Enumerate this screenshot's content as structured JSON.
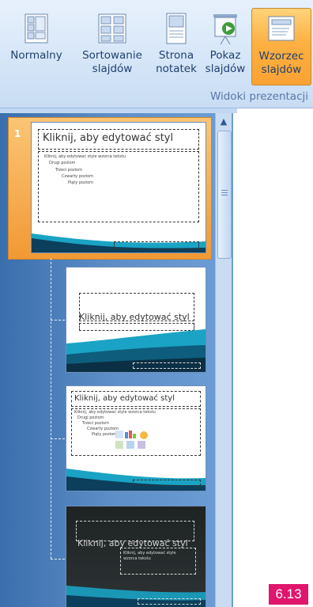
{
  "ribbon": {
    "buttons": [
      {
        "line1": "Normalny",
        "line2": "",
        "icon": "normal-view-icon"
      },
      {
        "line1": "Sortowanie",
        "line2": "slajdów",
        "icon": "slide-sorter-icon"
      },
      {
        "line1": "Strona",
        "line2": "notatek",
        "icon": "notes-page-icon"
      },
      {
        "line1": "Pokaz",
        "line2": "slajdów",
        "icon": "slide-show-icon"
      },
      {
        "line1": "Wzorzec",
        "line2": "slajdów",
        "icon": "slide-master-icon"
      }
    ],
    "group_label": "Widoki prezentacji"
  },
  "slides_panel": {
    "selected_number": "1",
    "master": {
      "title": "Kliknij, aby edytować styl",
      "body": [
        "Kliknij, aby edytować style wzorca tekstu",
        "Drugi poziom",
        "Trzeci poziom",
        "Czwarty poziom",
        "Piąty poziom"
      ]
    },
    "layout2": {
      "title": "Kliknij, aby edytować styl"
    },
    "layout3": {
      "title": "Kliknij, aby edytować styl",
      "body": [
        "Kliknij, aby edytować style wzorca tekstu",
        "Drugi poziom",
        "Trzeci poziom",
        "Czwarty poziom",
        "Piąty poziom"
      ]
    },
    "layout4": {
      "title": "Kliknij, aby edytować styl",
      "body": [
        "Kliknij, aby edytować style",
        "wzorca tekstu"
      ]
    }
  },
  "figure_label": "6.13",
  "colors": {
    "accent_active": "#f9a233",
    "panel_blue": "#5f8fc8",
    "wave_teal": "#1aa3c4",
    "label_magenta": "#e0166e"
  }
}
